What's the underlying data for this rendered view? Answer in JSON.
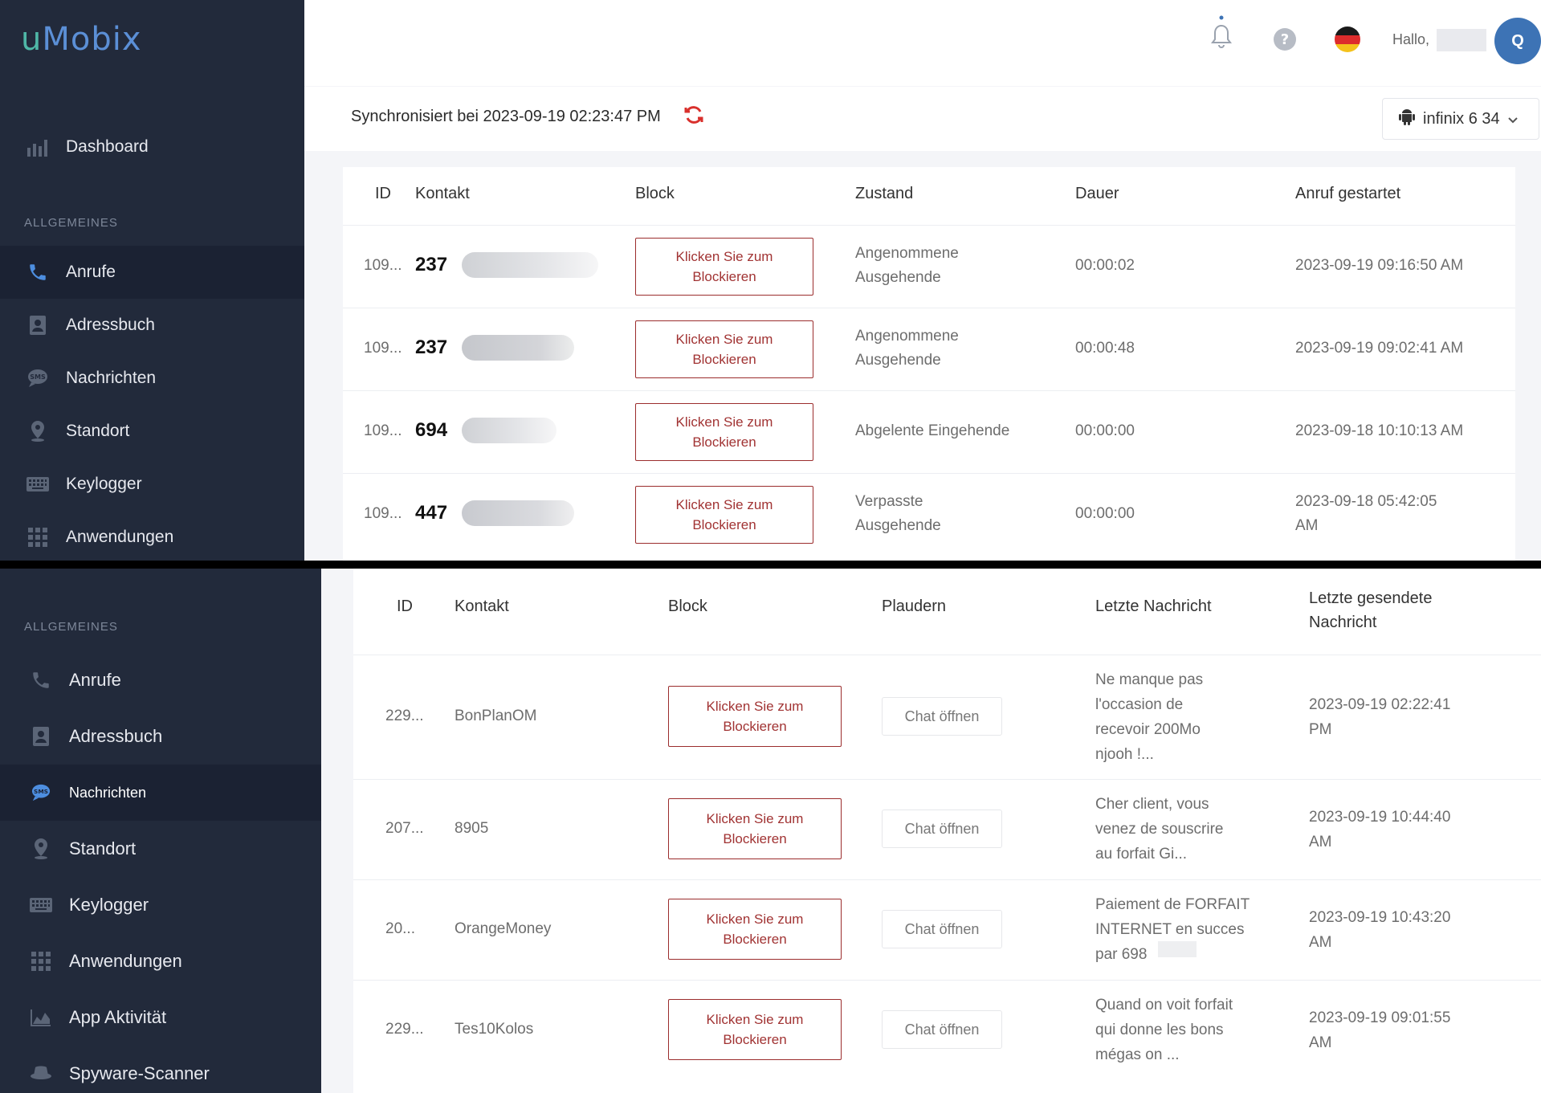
{
  "brand": {
    "logo_u": "u",
    "logo_rest": "Mobix"
  },
  "header": {
    "hello": "Hallo,",
    "avatar_initial": "Q",
    "sync_text": "Synchronisiert bei 2023-09-19 02:23:47 PM",
    "device": "infinix 6 34"
  },
  "sidebar_top": {
    "dashboard": "Dashboard",
    "section": "ALLGEMEINES",
    "items": [
      "Anrufe",
      "Adressbuch",
      "Nachrichten",
      "Standort",
      "Keylogger",
      "Anwendungen"
    ]
  },
  "calls": {
    "headers": [
      "ID",
      "Kontakt",
      "Block",
      "Zustand",
      "Dauer",
      "Anruf gestartet"
    ],
    "block_line1": "Klicken Sie zum",
    "block_line2": "Blockieren",
    "rows": [
      {
        "id": "109...",
        "contact": "237",
        "state1": "Angenommene",
        "state2": "Ausgehende",
        "duration": "00:00:02",
        "started1": "2023-09-19 09:16:50 AM",
        "started2": ""
      },
      {
        "id": "109...",
        "contact": "237",
        "state1": "Angenommene",
        "state2": "Ausgehende",
        "duration": "00:00:48",
        "started1": "2023-09-19 09:02:41 AM",
        "started2": ""
      },
      {
        "id": "109...",
        "contact": "694",
        "state1": "Abgelente Eingehende",
        "state2": "",
        "duration": "00:00:00",
        "started1": "2023-09-18 10:10:13 AM",
        "started2": ""
      },
      {
        "id": "109...",
        "contact": "447",
        "state1": "Verpasste",
        "state2": "Ausgehende",
        "duration": "00:00:00",
        "started1": "2023-09-18 05:42:05",
        "started2": "AM"
      }
    ]
  },
  "sidebar_bottom": {
    "section": "ALLGEMEINES",
    "items": [
      "Anrufe",
      "Adressbuch",
      "Nachrichten",
      "Standort",
      "Keylogger",
      "Anwendungen",
      "App Aktivität",
      "Spyware-Scanner"
    ]
  },
  "messages": {
    "headers": [
      "ID",
      "Kontakt",
      "Block",
      "Plaudern",
      "Letzte Nachricht",
      "Letzte gesendete",
      "Nachricht"
    ],
    "chat_label": "Chat öffnen",
    "rows": [
      {
        "id": "229...",
        "contact": "BonPlanOM",
        "msg": [
          "Ne manque pas",
          "l'occasion de",
          "recevoir 200Mo",
          "njooh !..."
        ],
        "sent1": "2023-09-19 02:22:41",
        "sent2": "PM"
      },
      {
        "id": "207...",
        "contact": "8905",
        "msg": [
          "Cher client, vous",
          "venez de souscrire",
          "au forfait Gi..."
        ],
        "sent1": "2023-09-19 10:44:40",
        "sent2": "AM"
      },
      {
        "id": "20...",
        "contact": "OrangeMoney",
        "msg": [
          "Paiement de FORFAIT",
          "INTERNET en succes",
          "par 698"
        ],
        "sent1": "2023-09-19 10:43:20",
        "sent2": "AM"
      },
      {
        "id": "229...",
        "contact": "Tes10Kolos",
        "msg": [
          "Quand on voit forfait",
          "qui donne les bons",
          "mégas on ..."
        ],
        "sent1": "2023-09-19 09:01:55",
        "sent2": "AM"
      }
    ]
  },
  "colors": {
    "sidebar": "#222a3b",
    "accent": "#3d73b5",
    "block_red": "#a13333",
    "logo_teal": "#4fb7a7"
  }
}
